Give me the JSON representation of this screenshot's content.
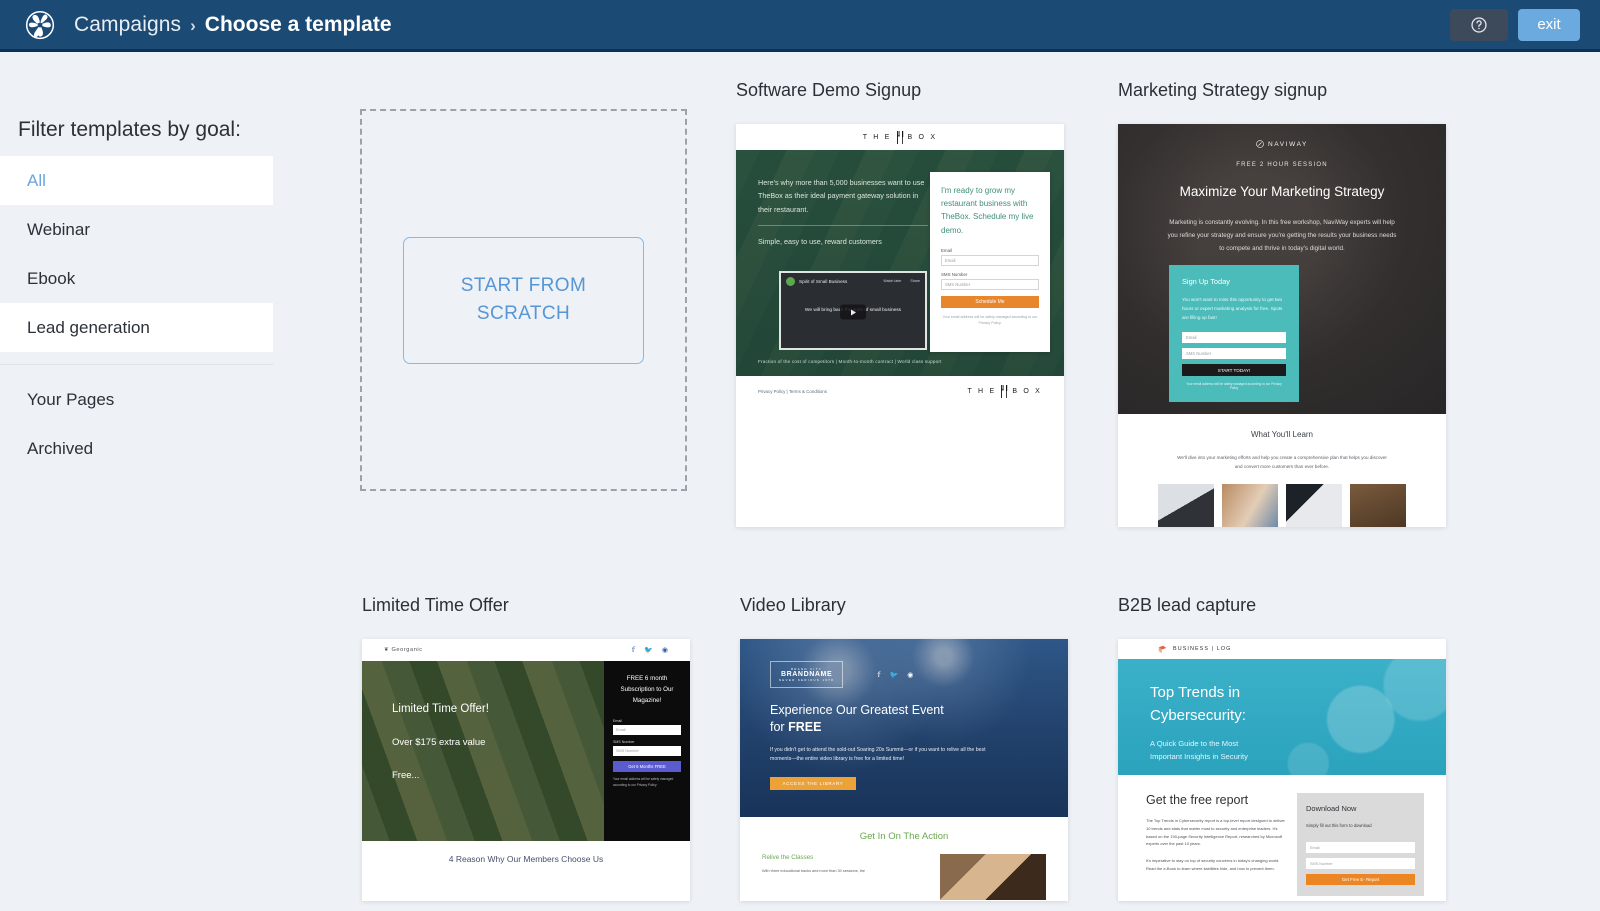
{
  "header": {
    "logo_icon": "pinwheel-logo",
    "breadcrumb_parent": "Campaigns",
    "breadcrumb_separator": "›",
    "breadcrumb_current": "Choose a template",
    "help_icon": "question-circle-icon",
    "exit_label": "exit",
    "bg_color": "#1b4b75",
    "exit_color": "#6aaade"
  },
  "sidebar": {
    "title": "Filter templates by goal:",
    "items": [
      {
        "label": "All",
        "state": "active"
      },
      {
        "label": "Webinar",
        "state": "default"
      },
      {
        "label": "Ebook",
        "state": "default"
      },
      {
        "label": "Lead generation",
        "state": "hover"
      }
    ],
    "secondary_items": [
      {
        "label": "Your Pages"
      },
      {
        "label": "Archived"
      }
    ],
    "active_color": "#6aa5dd"
  },
  "scratch": {
    "label_line1": "START FROM",
    "label_line2": "SCRATCH",
    "accent_color": "#5796d4"
  },
  "templates": [
    {
      "title": "Software Demo Signup",
      "brand": "THE BOX",
      "brand_pre": "T H E",
      "brand_post": "B O X",
      "hero_copy": "Here's why more than 5,000 businesses want to use TheBox as their ideal payment gateway solution in their restaurant.",
      "hero_sub": "Simple, easy to use, reward customers",
      "video_title": "Spirit of Small Business",
      "video_icon1": "Watch later",
      "video_icon2": "Share",
      "video_caption": "We will bring back the spirit of small business",
      "hero_foot": "Fraction of the cost of competitors | Month-to-month contract | World class support",
      "form_head": "I'm ready to grow my restaurant business with TheBox. Schedule my live demo.",
      "label_email": "Email",
      "placeholder_email": "Email",
      "label_sms": "SMS Number",
      "placeholder_sms": "SMS Number",
      "cta": "Schedule Me",
      "fine_print": "Your email address will be safely managed according to our Privacy Policy.",
      "footer_links": "Privacy Policy | Terms & Conditions",
      "cta_color": "#e8862b"
    },
    {
      "title": "Marketing Strategy signup",
      "brand": "NAVIWAY",
      "kicker": "FREE 2 HOUR SESSION",
      "headline": "Maximize Your Marketing Strategy",
      "subhead": "Marketing is constantly evolving. In this free workshop, NaviWay experts will help you refine your strategy and ensure you're getting the results your business needs to compete and thrive in today's digital world.",
      "form_head": "Sign Up Today",
      "form_p": "You won't want to miss this opportunity to get two hours or expert marketing analysis for free. Spots are filling up fast!",
      "placeholder_email": "Email",
      "placeholder_sms": "SMS Number",
      "cta": "START TODAY!",
      "fine_print": "Your email address will be safely managed according to our Privacy Policy",
      "section_head": "What You'll Learn",
      "section_p": "We'll dive into your marketing efforts and help you create a comprehensive plan that helps you discover and convert more customers than ever before.",
      "accent_color": "#4cbcbb"
    },
    {
      "title": "Limited Time Offer",
      "brand": "Georganic",
      "social": [
        "facebook-icon",
        "twitter-icon",
        "instagram-icon"
      ],
      "h1": "Limited Time Offer!",
      "h2": "Over $175 extra value",
      "h3": "Free...",
      "panel_head": "FREE 6 month Subscription to Our Magazine!",
      "label_email": "Email",
      "placeholder_email": "Email",
      "label_sms": "SMS Number",
      "placeholder_sms": "SMS Number",
      "cta": "Get 6 Months FREE",
      "fine_print": "Your email address will be safely managed according to our Privacy Policy",
      "footer_head": "4 Reason Why Our Members Choose Us",
      "cta_color": "#5b5bd0"
    },
    {
      "title": "Video Library",
      "brand_kicker": "BRAND CITY",
      "brand": "BRANDNAME",
      "brand_sub": "NEVER SERIOUS 1978",
      "social": [
        "facebook-icon",
        "twitter-icon",
        "instagram-icon"
      ],
      "h1_line1": "Experience Our Greatest Event",
      "h1_line2_pre": "for ",
      "h1_line2_strong": "FREE",
      "paragraph": "If you didn't get to attend the sold-out Soaring 20s Summit—or if you want to relive all the best moments—the entire video library is free for a limited time!",
      "cta": "ACCESS THE LIBRARY",
      "section_head": "Get In On The Action",
      "sub_head": "Relive the Classes",
      "sub_text": "With three educational tracks and more than 30 sessions, the",
      "cta_color": "#eca237",
      "accent_color": "#6aa84f"
    },
    {
      "title": "B2B lead capture",
      "brand": "BUSINESS | LOG",
      "h1_line1": "Top Trends in",
      "h1_line2": "Cybersecurity:",
      "sub_line1": "A Quick Guide to the Most",
      "sub_line2": "Important Insights in Security",
      "body_head": "Get the free report",
      "body_p1": "The Top Trends in Cybersecurity report is a top-level report designed to deliver 10 trends and stats that matter most to security and enterprise leaders. It's based on the 190-page Security Intelligence Report, researched by Microsoft experts over the past 10 years.",
      "body_p2": "It's imperative to stay on top of security concerns in today's changing world. Read the e-Book to learn where liabilities hide, and how to prevent them.",
      "form_head": "Download Now",
      "form_p": "Simply fill out this form to download",
      "placeholder_email": "Email",
      "placeholder_sms": "SMS Number",
      "cta": "Get Free E- Report",
      "accent_color": "#2ba3bd",
      "cta_color": "#ec8524"
    }
  ]
}
